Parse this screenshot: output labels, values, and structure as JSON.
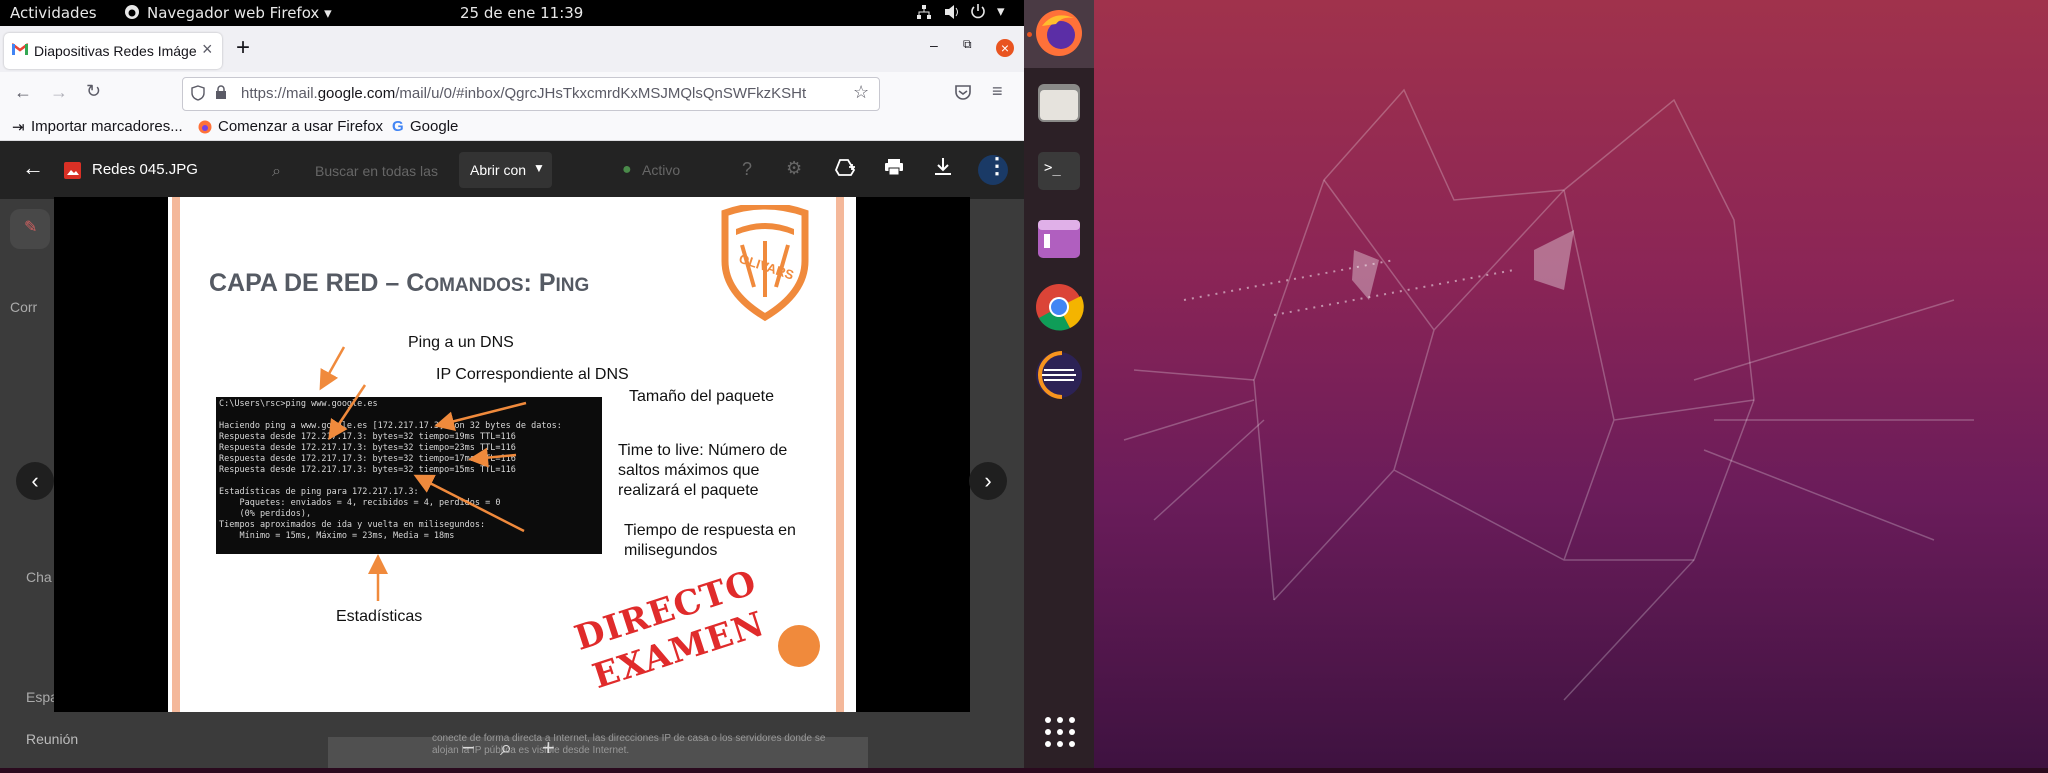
{
  "topbar": {
    "activities": "Actividades",
    "app_menu": "Navegador web Firefox",
    "clock": "25 de ene  11:39"
  },
  "browser": {
    "tab_title": "Diapositivas Redes Imáge",
    "url_prefix": "https://mail.",
    "url_domain": "google.com",
    "url_rest": "/mail/u/0/#inbox/QgrcJHsTkxcmrdKxMSJMQlsQnSWFkzKSHt",
    "bookmarks": [
      "Importar marcadores...",
      "Comenzar a usar Firefox",
      "Google"
    ]
  },
  "viewer": {
    "file_name": "Redes 045.JPG",
    "open_with": "Abrir con",
    "bg_search": "Buscar en todas las",
    "bg_status": "Activo",
    "bg_sidebar": [
      "Corr",
      "Cha",
      "Espa",
      "Reunión"
    ],
    "bg_text": [
      "conecte de forma directa a",
      "Internet, las direcciones IP de",
      "casa o los servidores donde",
      "se alojan la IP pública es visible desde",
      "Internet."
    ]
  },
  "slide": {
    "title_main": "CAPA DE RED – C",
    "title_small1": "OMANDOS",
    "title_mid": ": P",
    "title_small2": "ING",
    "logo_text": "OLIVARS",
    "terminal": "C:\\Users\\rsc>ping www.google.es\n\nHaciendo ping a www.google.es [172.217.17.3] con 32 bytes de datos:\nRespuesta desde 172.217.17.3: bytes=32 tiempo=19ms TTL=116\nRespuesta desde 172.217.17.3: bytes=32 tiempo=23ms TTL=116\nRespuesta desde 172.217.17.3: bytes=32 tiempo=17ms TTL=116\nRespuesta desde 172.217.17.3: bytes=32 tiempo=15ms TTL=116\n\nEstadísticas de ping para 172.217.17.3:\n    Paquetes: enviados = 4, recibidos = 4, perdidos = 0\n    (0% perdidos),\nTiempos aproximados de ida y vuelta en milisegundos:\n    Mínimo = 15ms, Máximo = 23ms, Media = 18ms",
    "notes": {
      "ping_dns": "Ping a un DNS",
      "ip_dns": "IP Correspondiente al DNS",
      "packet_size": "Tamaño del paquete",
      "ttl": "Time to live: Número de saltos máximos que realizará el paquete",
      "response_time": "Tiempo de respuesta en milisegundos",
      "stats": "Estadísticas"
    },
    "stamp_line1": "DIRECTO",
    "stamp_line2": "EXAMEN"
  },
  "colors": {
    "accent_orange": "#f08a3c",
    "stamp_red": "#e02b2b",
    "close_button": "#e95420"
  }
}
